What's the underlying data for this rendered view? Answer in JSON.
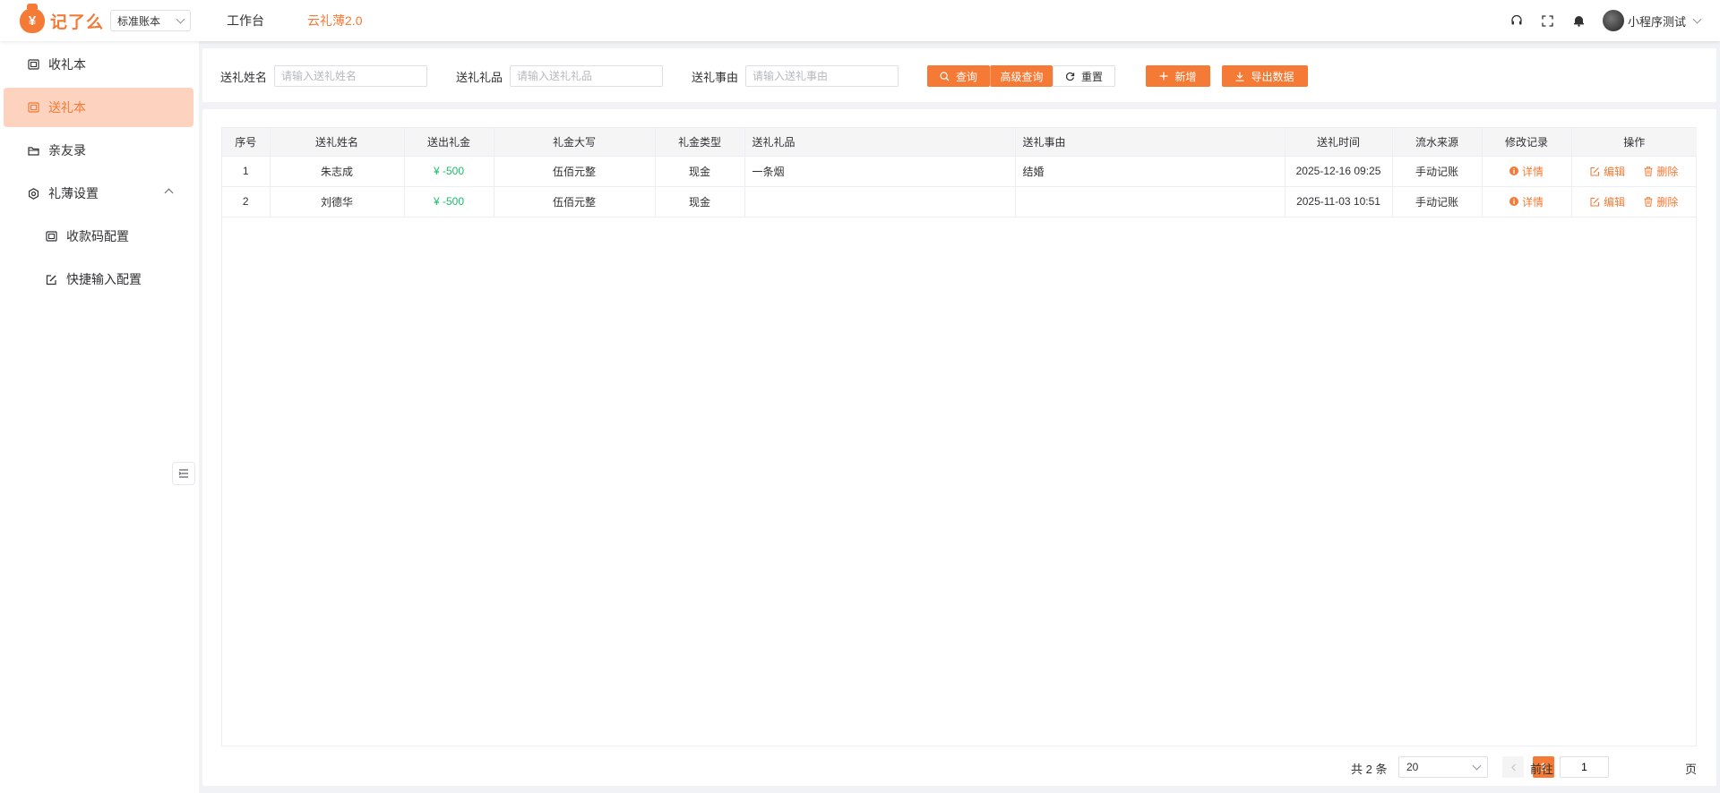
{
  "header": {
    "logo_text": "记了么",
    "logo_symbol": "¥",
    "book_select": "标准账本",
    "nav": [
      "工作台",
      "云礼薄2.0"
    ],
    "active_nav": 1,
    "user_name": "小程序测试",
    "icons": [
      "headset-icon",
      "fullscreen-icon",
      "bell-icon"
    ]
  },
  "sidebar": {
    "items": [
      {
        "label": "收礼本",
        "icon": "ledger-icon"
      },
      {
        "label": "送礼本",
        "icon": "ledger-icon",
        "active": true
      },
      {
        "label": "亲友录",
        "icon": "folder-icon"
      },
      {
        "label": "礼薄设置",
        "icon": "gear-icon",
        "expanded": true
      },
      {
        "label": "收款码配置",
        "icon": "qrcode-icon",
        "sub": true
      },
      {
        "label": "快捷输入配置",
        "icon": "edit-icon",
        "sub": true
      }
    ]
  },
  "search": {
    "name_label": "送礼姓名",
    "name_placeholder": "请输入送礼姓名",
    "gift_label": "送礼礼品",
    "gift_placeholder": "请输入送礼礼品",
    "reason_label": "送礼事由",
    "reason_placeholder": "请输入送礼事由",
    "query": "查询",
    "advanced": "高级查询",
    "reset": "重置",
    "add": "新增",
    "export": "导出数据"
  },
  "table": {
    "columns": [
      "序号",
      "送礼姓名",
      "送出礼金",
      "礼金大写",
      "礼金类型",
      "送礼礼品",
      "送礼事由",
      "送礼时间",
      "流水来源",
      "修改记录",
      "操作"
    ],
    "rows": [
      {
        "index": "1",
        "name": "朱志成",
        "amount": "¥ -500",
        "amount_cn": "伍佰元整",
        "type": "现金",
        "gift": "一条烟",
        "reason": "结婚",
        "time": "2025-12-16 09:25",
        "source": "手动记账",
        "record": "详情",
        "edit": "编辑",
        "delete": "删除"
      },
      {
        "index": "2",
        "name": "刘德华",
        "amount": "¥ -500",
        "amount_cn": "伍佰元整",
        "type": "现金",
        "gift": "",
        "reason": "",
        "time": "2025-11-03 10:51",
        "source": "手动记账",
        "record": "详情",
        "edit": "编辑",
        "delete": "删除"
      }
    ]
  },
  "pager": {
    "total": "共 2 条",
    "page_size": "20",
    "current_page": "1",
    "goto_label": "前往",
    "goto_value": "1",
    "page_suffix": "页"
  },
  "colors": {
    "accent": "#f47a35",
    "amount": "#19be6b",
    "active_bg": "#fdd2be"
  }
}
